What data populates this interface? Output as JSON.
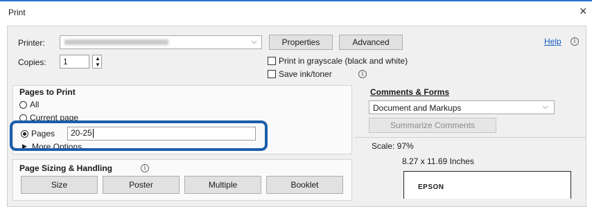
{
  "window": {
    "title": "Print",
    "close_glyph": "×"
  },
  "printer": {
    "label": "Printer:",
    "properties_label": "Properties",
    "advanced_label": "Advanced",
    "help_label": "Help"
  },
  "copies": {
    "label": "Copies:",
    "value": "1"
  },
  "options": {
    "grayscale_label": "Print in grayscale (black and white)",
    "grayscale_checked": false,
    "save_ink_label": "Save ink/toner",
    "save_ink_checked": false
  },
  "pages_to_print": {
    "heading": "Pages to Print",
    "all_label": "All",
    "current_label": "Current page",
    "pages_label": "Pages",
    "pages_value": "20-25",
    "more_options_label": "More Options",
    "selected": "Pages"
  },
  "comments_forms": {
    "heading": "Comments & Forms",
    "selected": "Document and Markups",
    "summarize_label": "Summarize Comments"
  },
  "preview": {
    "scale_text": "Scale: 97%",
    "size_text": "8.27 x 11.69 Inches",
    "brand_text": "EPSON"
  },
  "sizing": {
    "heading": "Page Sizing & Handling",
    "buttons": [
      "Size",
      "Poster",
      "Multiple",
      "Booklet"
    ]
  },
  "colors": {
    "accent": "#2a73c9",
    "highlight": "#1c5ea8"
  }
}
